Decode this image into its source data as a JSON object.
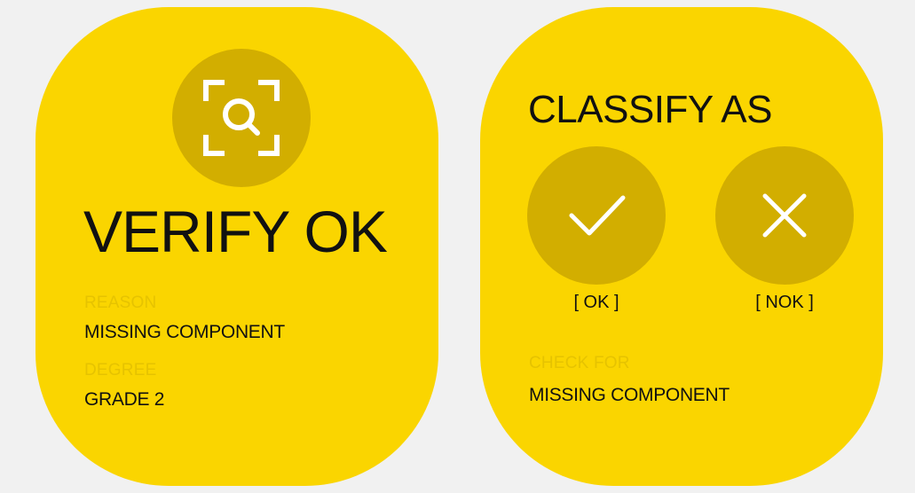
{
  "verify_card": {
    "icon": "scan-search-icon",
    "title": "VERIFY OK",
    "reason_label": "REASON",
    "reason_value": "MISSING COMPONENT",
    "degree_label": "DEGREE",
    "degree_value": "GRADE 2"
  },
  "classify_card": {
    "title": "CLASSIFY AS",
    "options": [
      {
        "icon": "check-icon",
        "label": "[ OK ]"
      },
      {
        "icon": "close-icon",
        "label": "[ NOK ]"
      }
    ],
    "check_label": "CHECK FOR",
    "check_value": "MISSING COMPONENT"
  },
  "colors": {
    "background": "#f1f1f1",
    "card": "#fad500",
    "circle": "#d2ae00",
    "label": "#e6c300",
    "text": "#111111",
    "icon": "#ffffff"
  }
}
